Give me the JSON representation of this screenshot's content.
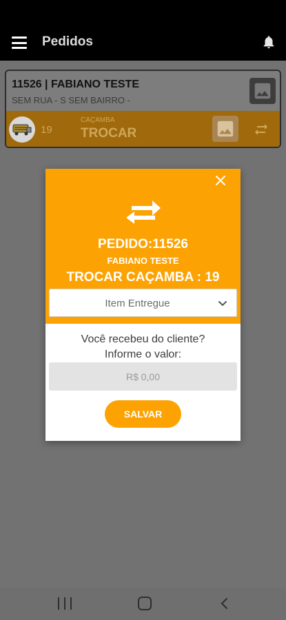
{
  "appbar": {
    "title": "Pedidos",
    "menu_icon": "hamburger-menu-icon",
    "notification_icon": "bell-icon"
  },
  "order": {
    "title": "11526 | FABIANO TESTE",
    "address": "SEM RUA - S SEM BAIRRO -",
    "count": "19",
    "label": "CAÇAMBA",
    "action": "TROCAR"
  },
  "modal": {
    "pedido": "PEDIDO:11526",
    "cliente": "FABIANO TESTE",
    "action": "TROCAR CAÇAMBA : 19",
    "select_value": "Item Entregue",
    "question_line1": "Você recebeu do cliente?",
    "question_line2": "Informe o valor:",
    "value_placeholder": "R$ 0,00",
    "save_label": "SALVAR"
  },
  "colors": {
    "accent": "#fca203",
    "appbar": "#000000",
    "overlay_bg": "#727272"
  }
}
